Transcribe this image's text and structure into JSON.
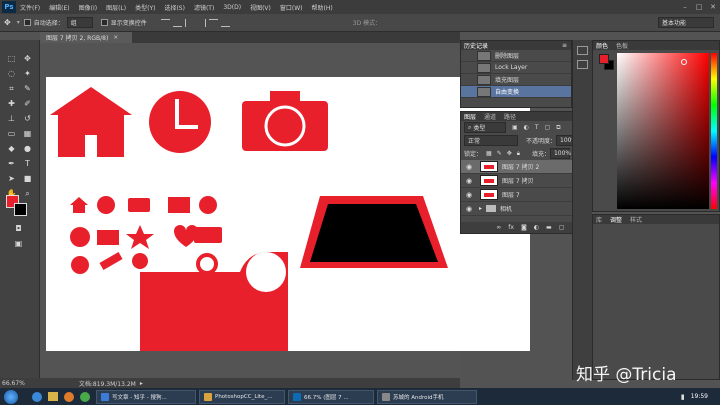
{
  "menu": {
    "logo": "Ps",
    "items": [
      "文件(F)",
      "编辑(E)",
      "图像(I)",
      "图层(L)",
      "类型(Y)",
      "选择(S)",
      "滤镜(T)",
      "3D(D)",
      "视图(V)",
      "窗口(W)",
      "帮助(H)"
    ]
  },
  "options": {
    "auto_select_label": "自动选择：",
    "auto_select_value": "组",
    "show_transform_label": "显示变换控件",
    "mode_3d_label": "3D 模式：",
    "workspace": "基本功能"
  },
  "document": {
    "tab_title": "图层 7 拷贝 2, RGB/8)",
    "zoom": "66.67%",
    "doc_size": "文档:819.3M/13.2M"
  },
  "history": {
    "tab_label": "历史记录",
    "items": [
      {
        "label": "删除图层",
        "selected": false
      },
      {
        "label": "Lock Layer",
        "selected": false
      },
      {
        "label": "填充图层",
        "selected": false
      },
      {
        "label": "自由变换",
        "selected": true
      }
    ]
  },
  "layers": {
    "tabs": [
      "图层",
      "通道",
      "路径"
    ],
    "filter_kind": "类型",
    "blend_mode": "正常",
    "opacity_label": "不透明度：",
    "opacity_value": "100%",
    "lock_label": "锁定：",
    "fill_label": "填充：",
    "fill_value": "100%",
    "items": [
      {
        "label": "图层 7 拷贝 2",
        "selected": true,
        "group": false
      },
      {
        "label": "图层 7 拷贝",
        "selected": false,
        "group": false
      },
      {
        "label": "图层 7",
        "selected": false,
        "group": false
      },
      {
        "label": "相机",
        "selected": false,
        "group": true
      }
    ]
  },
  "color_panel": {
    "tabs": [
      "颜色",
      "色板"
    ],
    "foreground": "#e8202c",
    "background": "#000000"
  },
  "adjust_panel": {
    "tabs": [
      "库",
      "调整",
      "样式"
    ]
  },
  "taskbar": {
    "items": [
      {
        "label": "写文章 - 知乎 - 搜狗...",
        "color": "#3d7bd9"
      },
      {
        "label": "PhotoshopCC_Lite_...",
        "color": "#d9a43d"
      },
      {
        "label": "66.7% (图层 7 ...",
        "color": "#0d6bb5"
      },
      {
        "label": "苏城的 Android手机",
        "color": "#888888"
      }
    ],
    "clock": "19:59"
  },
  "watermark": "知乎 @Tricia",
  "colors": {
    "accent_red": "#e8202c",
    "canvas": "#ffffff",
    "ui_dark": "#3c3c3c"
  }
}
